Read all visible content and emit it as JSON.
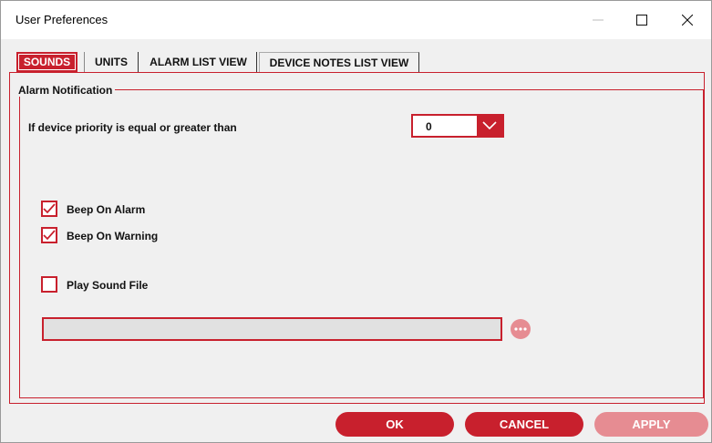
{
  "window": {
    "title": "User Preferences"
  },
  "tabs": [
    {
      "label": "SOUNDS",
      "active": true
    },
    {
      "label": "UNITS",
      "active": false
    },
    {
      "label": "ALARM LIST VIEW",
      "active": false
    },
    {
      "label": "DEVICE NOTES LIST VIEW",
      "active": false
    }
  ],
  "alarm_notification": {
    "legend": "Alarm Notification",
    "priority_label": "If device priority is equal or greater than",
    "priority_value": "0",
    "beep_on_alarm": {
      "label": "Beep On Alarm",
      "checked": true
    },
    "beep_on_warning": {
      "label": "Beep On Warning",
      "checked": true
    },
    "play_sound_file": {
      "label": "Play Sound File",
      "checked": false
    },
    "sound_file_path": ""
  },
  "buttons": {
    "ok": "OK",
    "cancel": "CANCEL",
    "apply": "APPLY"
  },
  "colors": {
    "accent": "#c8202d",
    "accent_disabled": "#e68c92",
    "background": "#f0f0f0"
  }
}
